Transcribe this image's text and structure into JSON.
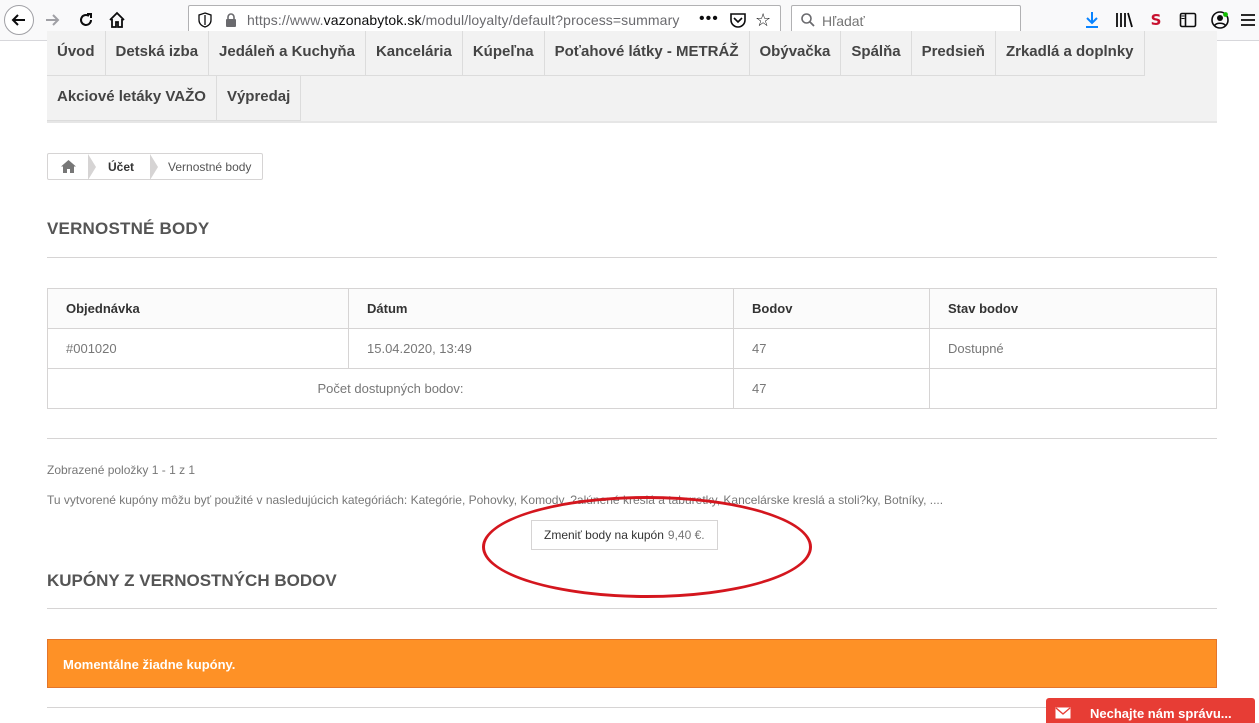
{
  "browser": {
    "url_prefix": "https://www.",
    "url_domain": "vazonabytok.sk",
    "url_path": "/modul/loyalty/default?process=summary",
    "more_label": "•••",
    "search_placeholder": "Hľadať"
  },
  "menu": {
    "row1": [
      "Úvod",
      "Detská izba",
      "Jedáleň a Kuchyňa",
      "Kancelária",
      "Kúpeľna",
      "Poťahové látky - METRÁŽ",
      "Obývačka",
      "Spálňa",
      "Predsieň",
      "Zrkadlá a doplnky"
    ],
    "row2": [
      "Akciové letáky VAŽO",
      "Výpredaj"
    ]
  },
  "breadcrumb": {
    "home_icon": "home-icon",
    "account": "Účet",
    "current": "Vernostné body"
  },
  "page_title": "VERNOSTNÉ BODY",
  "table": {
    "headers": [
      "Objednávka",
      "Dátum",
      "Bodov",
      "Stav bodov"
    ],
    "rows": [
      {
        "order": "#001020",
        "date": "15.04.2020, 13:49",
        "points": "47",
        "status": "Dostupné"
      }
    ],
    "total_label": "Počet dostupných bodov:",
    "total_value": "47"
  },
  "pager_text": "Zobrazené položky 1 - 1 z 1",
  "info_text": "Tu vytvorené kupóny môžu byť použité v nasledujúcich kategóriách: Kategórie, Pohovky, Komody, ?alúnené kreslá a taburetky, Kancelárske kreslá a stoli?ky, Botníky, ....",
  "convert_button": {
    "label": "Zmeniť body na kupón",
    "amount": "9,40 €."
  },
  "coupons_title": "KUPÓNY Z VERNOSTNÝCH BODOV",
  "coupons_empty": "Momentálne žiadne kupóny.",
  "chat_label": "Nechajte nám správu...",
  "colors": {
    "alert": "#fe9126",
    "chat": "#e73d35",
    "annotation": "#d4161e",
    "download_icon": "#0a84ff"
  }
}
